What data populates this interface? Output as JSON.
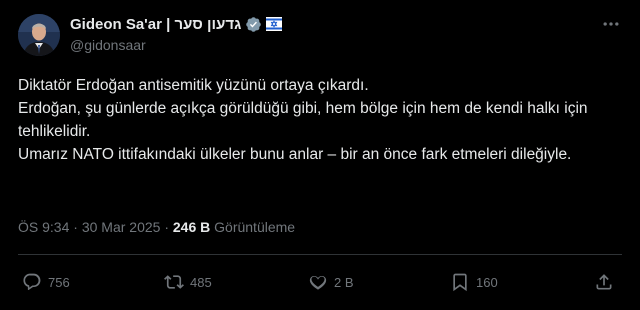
{
  "author": {
    "name": "Gideon Sa'ar | גדעון סער",
    "handle": "@gidonsaar"
  },
  "body": {
    "lines": [
      "Diktatör Erdoğan antisemitik yüzünü ortaya çıkardı.",
      "Erdoğan, şu günlerde açıkça görüldüğü gibi, hem bölge için hem de kendi halkı için tehlikelidir.",
      "Umarız NATO ittifakındaki ülkeler bunu anlar – bir an önce fark etmeleri dileğiyle."
    ]
  },
  "meta": {
    "time": "ÖS 9:34",
    "date": "30 Mar 2025",
    "separator": "·",
    "views_count": "246 B",
    "views_label": "Görüntüleme"
  },
  "actions": {
    "reply": "756",
    "repost": "485",
    "like": "2 B",
    "bookmark": "160"
  },
  "colors": {
    "background": "#000000",
    "text": "#e7e9ea",
    "secondary": "#71767b",
    "divider": "#2f3336",
    "verified": "#829aab"
  },
  "icons": {
    "verified": "verified-badge-icon",
    "flag": "israel-flag-icon",
    "more": "more-dots-icon",
    "reply": "reply-bubble-icon",
    "repost": "repost-icon",
    "like": "heart-icon",
    "bookmark": "bookmark-icon",
    "share": "share-icon"
  }
}
